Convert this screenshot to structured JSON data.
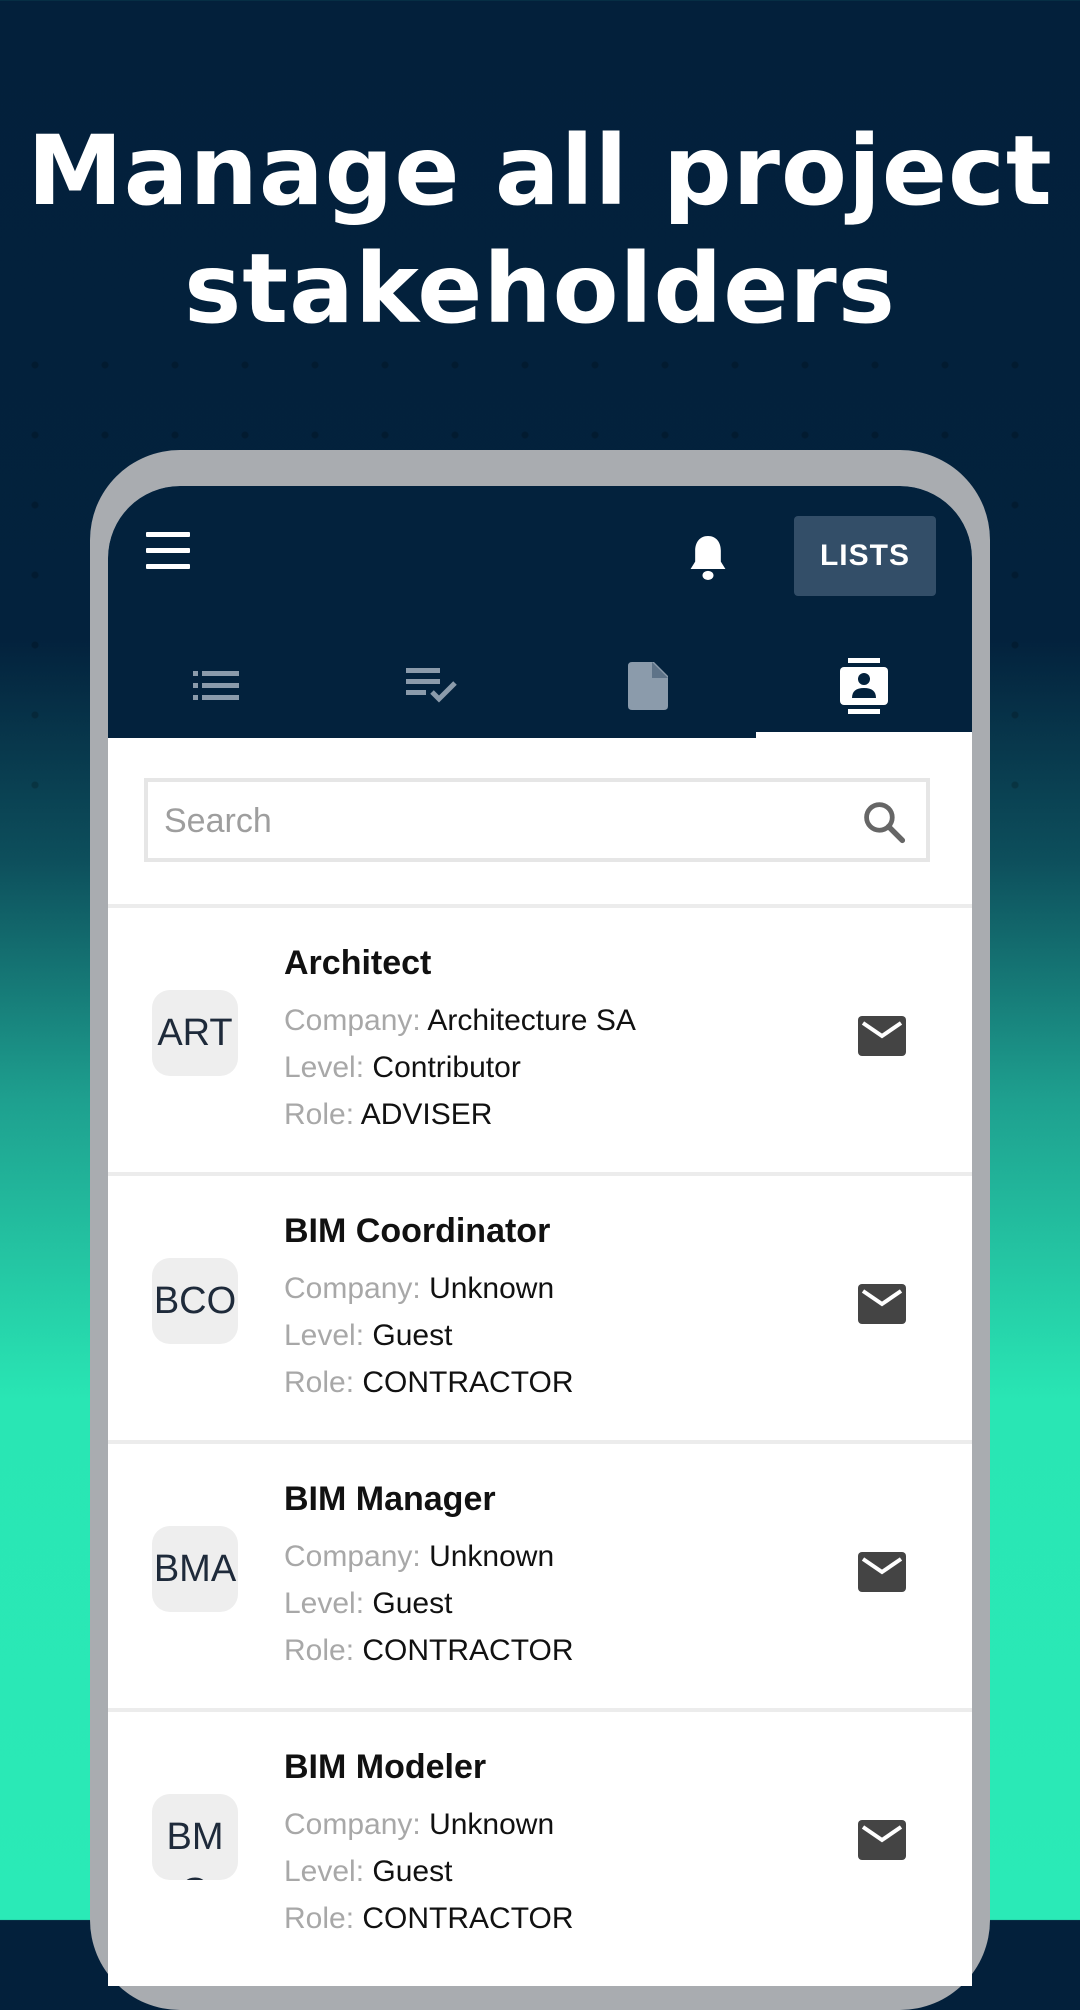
{
  "headline": {
    "line1": "Manage all project",
    "line2": "stakeholders"
  },
  "appbar": {
    "menu_icon": "hamburger-menu-icon",
    "bell_icon": "bell-icon",
    "lists_label": "LISTS",
    "tabs": [
      {
        "icon": "list-icon",
        "active": false
      },
      {
        "icon": "checklist-icon",
        "active": false
      },
      {
        "icon": "document-icon",
        "active": false
      },
      {
        "icon": "contact-card-icon",
        "active": true
      }
    ]
  },
  "search": {
    "placeholder": "Search",
    "icon": "search-icon"
  },
  "labels": {
    "company": "Company:",
    "level": "Level:",
    "role": "Role:"
  },
  "stakeholders": [
    {
      "initials": "ART",
      "title": "Architect",
      "company": "Architecture SA",
      "level": "Contributor",
      "role": "ADVISER"
    },
    {
      "initials": "BCO",
      "title": "BIM Coordinator",
      "company": "Unknown",
      "level": "Guest",
      "role": "CONTRACTOR"
    },
    {
      "initials": "BMA",
      "title": "BIM Manager",
      "company": "Unknown",
      "level": "Guest",
      "role": "CONTRACTOR"
    },
    {
      "initials": "BMO",
      "title": "BIM Modeler",
      "company": "Unknown",
      "level": "Guest",
      "role": "CONTRACTOR"
    }
  ],
  "colors": {
    "navy": "#03223d",
    "lists_button": "#334e68",
    "teal": "#2aeab7",
    "icon_inactive": "#8b9bab",
    "mail_icon": "#444444"
  }
}
